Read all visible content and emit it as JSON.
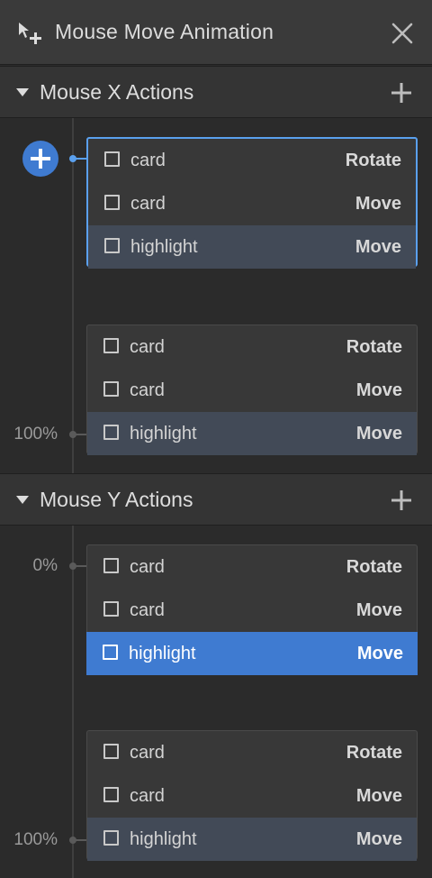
{
  "header": {
    "title": "Mouse Move Animation",
    "icon": "cursor-move-icon",
    "close_icon": "close-icon"
  },
  "sections": [
    {
      "label": "Mouse X Actions",
      "keyframes": [
        {
          "percent": "",
          "rows": [
            {
              "name": "card",
              "action": "Rotate"
            },
            {
              "name": "card",
              "action": "Move"
            },
            {
              "name": "highlight",
              "action": "Move"
            }
          ]
        },
        {
          "percent": "100%",
          "rows": [
            {
              "name": "card",
              "action": "Rotate"
            },
            {
              "name": "card",
              "action": "Move"
            },
            {
              "name": "highlight",
              "action": "Move"
            }
          ]
        }
      ]
    },
    {
      "label": "Mouse Y Actions",
      "keyframes": [
        {
          "percent": "0%",
          "rows": [
            {
              "name": "card",
              "action": "Rotate"
            },
            {
              "name": "card",
              "action": "Move"
            },
            {
              "name": "highlight",
              "action": "Move"
            }
          ]
        },
        {
          "percent": "100%",
          "rows": [
            {
              "name": "card",
              "action": "Rotate"
            },
            {
              "name": "card",
              "action": "Move"
            },
            {
              "name": "highlight",
              "action": "Move"
            }
          ]
        }
      ]
    }
  ],
  "colors": {
    "accent": "#3f7bd1",
    "selection_border": "#5aa0ee",
    "highlight_row": "#424a57"
  }
}
